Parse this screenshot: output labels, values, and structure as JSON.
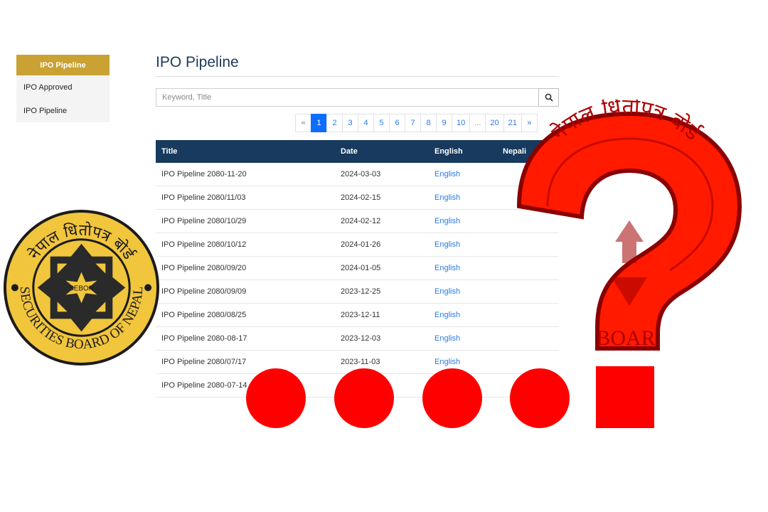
{
  "sidebar": {
    "items": [
      {
        "label": "IPO Pipeline",
        "active": true
      },
      {
        "label": "IPO Approved"
      },
      {
        "label": "IPO Pipeline"
      }
    ]
  },
  "main": {
    "title": "IPO Pipeline",
    "search": {
      "placeholder": "Keyword, Title",
      "value": ""
    },
    "pagination": {
      "prev": "«",
      "pages": [
        "1",
        "2",
        "3",
        "4",
        "5",
        "6",
        "7",
        "8",
        "9",
        "10",
        "...",
        "20",
        "21"
      ],
      "current": "1",
      "next": "»"
    },
    "table": {
      "headers": [
        "Title",
        "Date",
        "English",
        "Nepali"
      ],
      "rows": [
        {
          "title": "IPO Pipeline 2080-11-20",
          "date": "2024-03-03",
          "english": "English",
          "nepali": ""
        },
        {
          "title": "IPO Pipeline 2080/11/03",
          "date": "2024-02-15",
          "english": "English",
          "nepali": ""
        },
        {
          "title": "IPO Pipeline 2080/10/29",
          "date": "2024-02-12",
          "english": "English",
          "nepali": ""
        },
        {
          "title": "IPO Pipeline 2080/10/12",
          "date": "2024-01-26",
          "english": "English",
          "nepali": ""
        },
        {
          "title": "IPO Pipeline 2080/09/20",
          "date": "2024-01-05",
          "english": "English",
          "nepali": ""
        },
        {
          "title": "IPO Pipeline 2080/09/09",
          "date": "2023-12-25",
          "english": "English",
          "nepali": ""
        },
        {
          "title": "IPO Pipeline 2080/08/25",
          "date": "2023-12-11",
          "english": "English",
          "nepali": ""
        },
        {
          "title": "IPO Pipeline 2080-08-17",
          "date": "2023-12-03",
          "english": "English",
          "nepali": ""
        },
        {
          "title": "IPO Pipeline 2080/07/17",
          "date": "2023-11-03",
          "english": "English",
          "nepali": ""
        },
        {
          "title": "IPO Pipeline 2080-07-14",
          "date": "",
          "english": "",
          "nepali": ""
        }
      ]
    }
  },
  "overlay": {
    "seal": {
      "top_text": "नेपाल धितोपत्र बोर्ड",
      "bottom_text": "SECURITIES BOARD OF NEPAL",
      "center_text": "SEBON"
    },
    "question_mark_seal": {
      "top_text": "नेपाल धितोपत्र बोर्ड",
      "partial_text": "BOAR"
    },
    "dots_count": 4
  },
  "colors": {
    "sidebar_active": "#c9a233",
    "table_header": "#173a5e",
    "link": "#2a7ae2",
    "pager_active": "#0d6efd",
    "overlay_red": "#ff0000",
    "seal_yellow": "#f1c53c"
  },
  "icons": {
    "search_button": "search-icon"
  }
}
